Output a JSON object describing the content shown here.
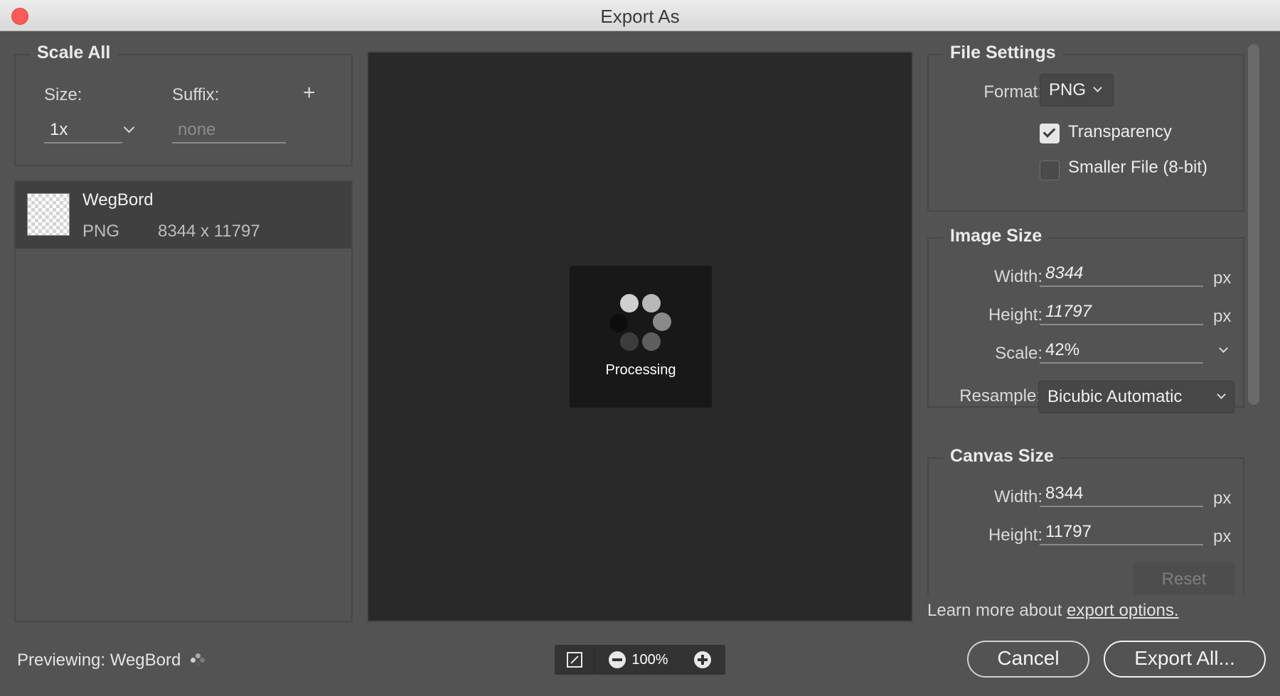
{
  "window": {
    "title": "Export As"
  },
  "scale_all": {
    "legend": "Scale All",
    "size_label": "Size:",
    "suffix_label": "Suffix:",
    "add_symbol": "+",
    "size_value": "1x",
    "suffix_placeholder": "none"
  },
  "assets": [
    {
      "name": "WegBord",
      "format": "PNG",
      "dimensions": "8344 x 11797"
    }
  ],
  "preview": {
    "status_text": "Processing"
  },
  "file_settings": {
    "legend": "File Settings",
    "format_label": "Format:",
    "format_value": "PNG",
    "transparency_label": "Transparency",
    "transparency_checked": true,
    "smaller_file_label": "Smaller File (8-bit)",
    "smaller_file_checked": false
  },
  "image_size": {
    "legend": "Image Size",
    "width_label": "Width:",
    "width_value": "8344",
    "height_label": "Height:",
    "height_value": "11797",
    "scale_label": "Scale:",
    "scale_value": "42%",
    "resample_label": "Resample:",
    "resample_value": "Bicubic Automatic",
    "unit": "px"
  },
  "canvas_size": {
    "legend": "Canvas Size",
    "width_label": "Width:",
    "width_value": "8344",
    "height_label": "Height:",
    "height_value": "11797",
    "unit": "px",
    "reset_label": "Reset"
  },
  "learn_more": {
    "prefix": "Learn more about ",
    "link": "export options."
  },
  "footer": {
    "previewing_label": "Previewing:",
    "previewing_name": "WegBord",
    "zoom_level": "100%",
    "cancel_label": "Cancel",
    "export_label": "Export All..."
  },
  "colors": {
    "background": "#535353",
    "preview_background": "#292929",
    "close_button": "#fc5b57"
  }
}
